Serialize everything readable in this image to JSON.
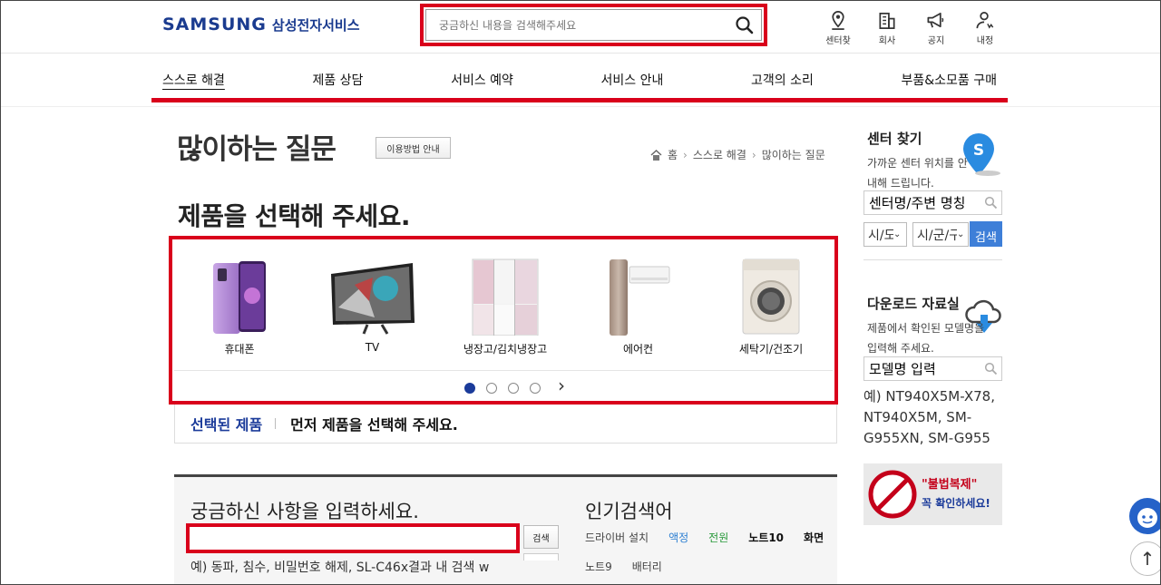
{
  "header": {
    "brand": "SAMSUNG",
    "brand_sub": "삼성전자서비스",
    "search_placeholder": "궁금하신 내용을 검색해주세요",
    "icons": [
      {
        "label": "센터찾",
        "icon": "location-icon"
      },
      {
        "label": "회사",
        "icon": "building-icon"
      },
      {
        "label": "공지",
        "icon": "megaphone-icon"
      },
      {
        "label": "내정",
        "icon": "user-icon"
      }
    ]
  },
  "gnb": {
    "items": [
      "스스로 해결",
      "제품 상담",
      "서비스 예약",
      "서비스 안내",
      "고객의 소리",
      "부품&소모품 구매"
    ],
    "active_index": 0
  },
  "main": {
    "page_title": "많이하는 질문",
    "guide_button": "이용방법 안내",
    "breadcrumb": [
      "홈",
      "스스로 해결",
      "많이하는 질문"
    ],
    "select_title": "제품을 선택해 주세요.",
    "products": [
      {
        "name": "휴대폰",
        "icon": "phone-icon"
      },
      {
        "name": "TV",
        "icon": "tv-icon"
      },
      {
        "name": "냉장고/김치냉장고",
        "icon": "refrigerator-icon"
      },
      {
        "name": "에어컨",
        "icon": "air-conditioner-icon"
      },
      {
        "name": "세탁기/건조기",
        "icon": "washer-icon"
      }
    ],
    "carousel_pages": 4,
    "carousel_current": 1,
    "selected_label": "선택된 제품",
    "selected_message": "먼저 제품을 선택해 주세요."
  },
  "faq": {
    "title": "궁금하신 사항을 입력하세요.",
    "input_value": "",
    "search_button": "검색",
    "example": "예) 동파, 침수, 비밀번호 해제, SL-C46x결과 내 검색 w",
    "popular_title": "인기검색어",
    "popular_words": [
      {
        "text": "드라이버 설치",
        "color": "#444444",
        "bold": false
      },
      {
        "text": "액정",
        "color": "#2d7fd2",
        "bold": false
      },
      {
        "text": "전원",
        "color": "#2a9a3c",
        "bold": false
      },
      {
        "text": "노트10",
        "color": "#111111",
        "bold": true
      },
      {
        "text": "화면",
        "color": "#111111",
        "bold": true
      },
      {
        "text": "노트9",
        "color": "#444444",
        "bold": false
      },
      {
        "text": "배터리",
        "color": "#444444",
        "bold": false
      }
    ]
  },
  "side": {
    "center_title": "센터 찾기",
    "center_desc": "가까운 센터 위치를 안내해 드립니다.",
    "center_input_value": "센터명/주변 명칭",
    "sido_value": "시/도",
    "sigungu_value": "시/군/구",
    "center_search_button": "검색",
    "download_title": "다운로드 자료실",
    "download_desc": "제품에서 확인된 모델명을 입력해 주세요.",
    "download_input_value": "모델명 입력",
    "download_example": "예) NT940X5M-X78, NT940X5M, SM-G955XN, SM-G955",
    "banner_line1": "\"불법복제\"",
    "banner_line2": "꼭 확인하세요!"
  },
  "colors": {
    "accent_red": "#d9001b",
    "brand_blue": "#1b3b9a"
  }
}
